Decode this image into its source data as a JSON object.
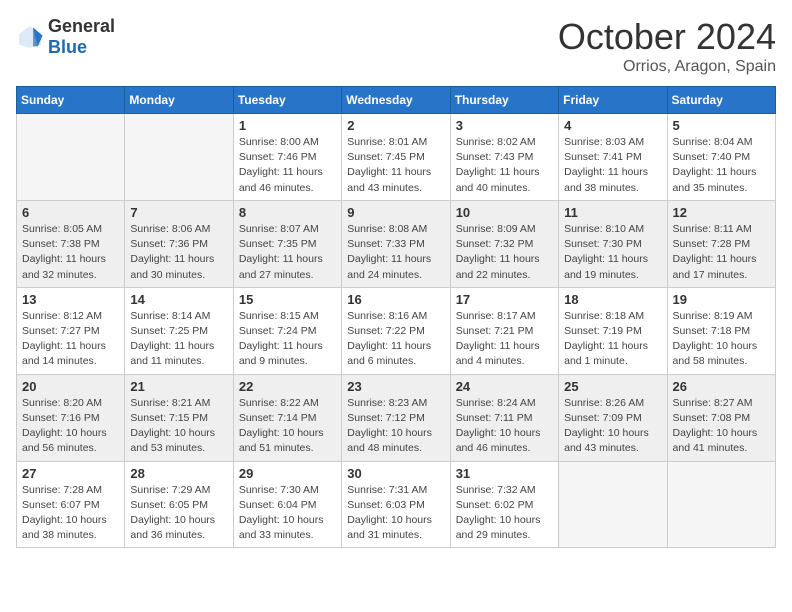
{
  "header": {
    "logo_general": "General",
    "logo_blue": "Blue",
    "month": "October 2024",
    "location": "Orrios, Aragon, Spain"
  },
  "days_of_week": [
    "Sunday",
    "Monday",
    "Tuesday",
    "Wednesday",
    "Thursday",
    "Friday",
    "Saturday"
  ],
  "weeks": [
    [
      {
        "day": "",
        "info": ""
      },
      {
        "day": "",
        "info": ""
      },
      {
        "day": "1",
        "info": "Sunrise: 8:00 AM\nSunset: 7:46 PM\nDaylight: 11 hours and 46 minutes."
      },
      {
        "day": "2",
        "info": "Sunrise: 8:01 AM\nSunset: 7:45 PM\nDaylight: 11 hours and 43 minutes."
      },
      {
        "day": "3",
        "info": "Sunrise: 8:02 AM\nSunset: 7:43 PM\nDaylight: 11 hours and 40 minutes."
      },
      {
        "day": "4",
        "info": "Sunrise: 8:03 AM\nSunset: 7:41 PM\nDaylight: 11 hours and 38 minutes."
      },
      {
        "day": "5",
        "info": "Sunrise: 8:04 AM\nSunset: 7:40 PM\nDaylight: 11 hours and 35 minutes."
      }
    ],
    [
      {
        "day": "6",
        "info": "Sunrise: 8:05 AM\nSunset: 7:38 PM\nDaylight: 11 hours and 32 minutes."
      },
      {
        "day": "7",
        "info": "Sunrise: 8:06 AM\nSunset: 7:36 PM\nDaylight: 11 hours and 30 minutes."
      },
      {
        "day": "8",
        "info": "Sunrise: 8:07 AM\nSunset: 7:35 PM\nDaylight: 11 hours and 27 minutes."
      },
      {
        "day": "9",
        "info": "Sunrise: 8:08 AM\nSunset: 7:33 PM\nDaylight: 11 hours and 24 minutes."
      },
      {
        "day": "10",
        "info": "Sunrise: 8:09 AM\nSunset: 7:32 PM\nDaylight: 11 hours and 22 minutes."
      },
      {
        "day": "11",
        "info": "Sunrise: 8:10 AM\nSunset: 7:30 PM\nDaylight: 11 hours and 19 minutes."
      },
      {
        "day": "12",
        "info": "Sunrise: 8:11 AM\nSunset: 7:28 PM\nDaylight: 11 hours and 17 minutes."
      }
    ],
    [
      {
        "day": "13",
        "info": "Sunrise: 8:12 AM\nSunset: 7:27 PM\nDaylight: 11 hours and 14 minutes."
      },
      {
        "day": "14",
        "info": "Sunrise: 8:14 AM\nSunset: 7:25 PM\nDaylight: 11 hours and 11 minutes."
      },
      {
        "day": "15",
        "info": "Sunrise: 8:15 AM\nSunset: 7:24 PM\nDaylight: 11 hours and 9 minutes."
      },
      {
        "day": "16",
        "info": "Sunrise: 8:16 AM\nSunset: 7:22 PM\nDaylight: 11 hours and 6 minutes."
      },
      {
        "day": "17",
        "info": "Sunrise: 8:17 AM\nSunset: 7:21 PM\nDaylight: 11 hours and 4 minutes."
      },
      {
        "day": "18",
        "info": "Sunrise: 8:18 AM\nSunset: 7:19 PM\nDaylight: 11 hours and 1 minute."
      },
      {
        "day": "19",
        "info": "Sunrise: 8:19 AM\nSunset: 7:18 PM\nDaylight: 10 hours and 58 minutes."
      }
    ],
    [
      {
        "day": "20",
        "info": "Sunrise: 8:20 AM\nSunset: 7:16 PM\nDaylight: 10 hours and 56 minutes."
      },
      {
        "day": "21",
        "info": "Sunrise: 8:21 AM\nSunset: 7:15 PM\nDaylight: 10 hours and 53 minutes."
      },
      {
        "day": "22",
        "info": "Sunrise: 8:22 AM\nSunset: 7:14 PM\nDaylight: 10 hours and 51 minutes."
      },
      {
        "day": "23",
        "info": "Sunrise: 8:23 AM\nSunset: 7:12 PM\nDaylight: 10 hours and 48 minutes."
      },
      {
        "day": "24",
        "info": "Sunrise: 8:24 AM\nSunset: 7:11 PM\nDaylight: 10 hours and 46 minutes."
      },
      {
        "day": "25",
        "info": "Sunrise: 8:26 AM\nSunset: 7:09 PM\nDaylight: 10 hours and 43 minutes."
      },
      {
        "day": "26",
        "info": "Sunrise: 8:27 AM\nSunset: 7:08 PM\nDaylight: 10 hours and 41 minutes."
      }
    ],
    [
      {
        "day": "27",
        "info": "Sunrise: 7:28 AM\nSunset: 6:07 PM\nDaylight: 10 hours and 38 minutes."
      },
      {
        "day": "28",
        "info": "Sunrise: 7:29 AM\nSunset: 6:05 PM\nDaylight: 10 hours and 36 minutes."
      },
      {
        "day": "29",
        "info": "Sunrise: 7:30 AM\nSunset: 6:04 PM\nDaylight: 10 hours and 33 minutes."
      },
      {
        "day": "30",
        "info": "Sunrise: 7:31 AM\nSunset: 6:03 PM\nDaylight: 10 hours and 31 minutes."
      },
      {
        "day": "31",
        "info": "Sunrise: 7:32 AM\nSunset: 6:02 PM\nDaylight: 10 hours and 29 minutes."
      },
      {
        "day": "",
        "info": ""
      },
      {
        "day": "",
        "info": ""
      }
    ]
  ]
}
